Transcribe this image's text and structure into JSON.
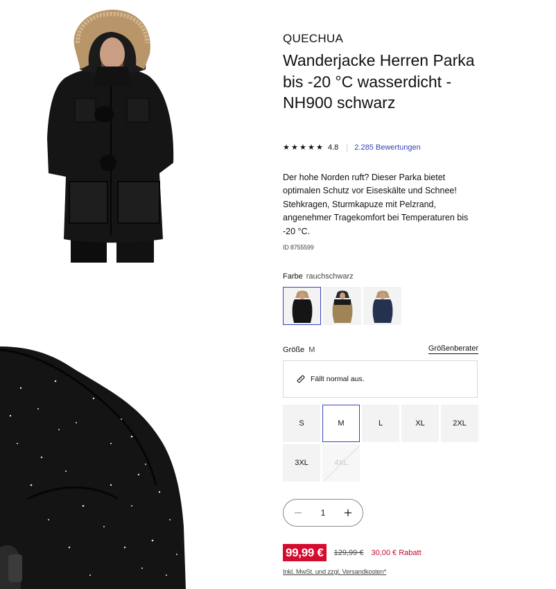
{
  "product": {
    "brand": "QUECHUA",
    "title": "Wanderjacke Herren Parka bis -20 °C wasserdicht - NH900 schwarz",
    "rating": "4.8",
    "stars": 5,
    "reviews_link": "2.285 Bewertungen",
    "description": "Der hohe Norden ruft? Dieser Parka bietet optimalen Schutz vor Eiseskälte und Schnee! Stehkragen, Sturmkapuze mit Pelzrand, angenehmer Tragekomfort bei Temperaturen bis -20 °C.",
    "id_text": "ID 8755599"
  },
  "color": {
    "label": "Farbe",
    "selected": "rauchschwarz",
    "swatches": [
      {
        "name": "rauchschwarz",
        "color": "#1a1a1a",
        "selected": true
      },
      {
        "name": "beige",
        "color": "#a08456",
        "selected": false
      },
      {
        "name": "navy",
        "color": "#25324f",
        "selected": false
      }
    ]
  },
  "size": {
    "label": "Größe",
    "selected": "M",
    "guide_link": "Größenberater",
    "fit_note": "Fällt normal aus.",
    "options": [
      {
        "label": "S",
        "selected": false,
        "available": true
      },
      {
        "label": "M",
        "selected": true,
        "available": true
      },
      {
        "label": "L",
        "selected": false,
        "available": true
      },
      {
        "label": "XL",
        "selected": false,
        "available": true
      },
      {
        "label": "2XL",
        "selected": false,
        "available": true
      },
      {
        "label": "3XL",
        "selected": false,
        "available": true
      },
      {
        "label": "4XL",
        "selected": false,
        "available": false
      }
    ]
  },
  "quantity": {
    "value": "1"
  },
  "price": {
    "current": "99,99 €",
    "old": "129,99 €",
    "discount": "30,00 € Rabatt",
    "tax_note": "Inkl. MwSt. und zzgl. Versandkosten*"
  },
  "colors": {
    "accent": "#3643ba",
    "price_red": "#d50c2f"
  }
}
